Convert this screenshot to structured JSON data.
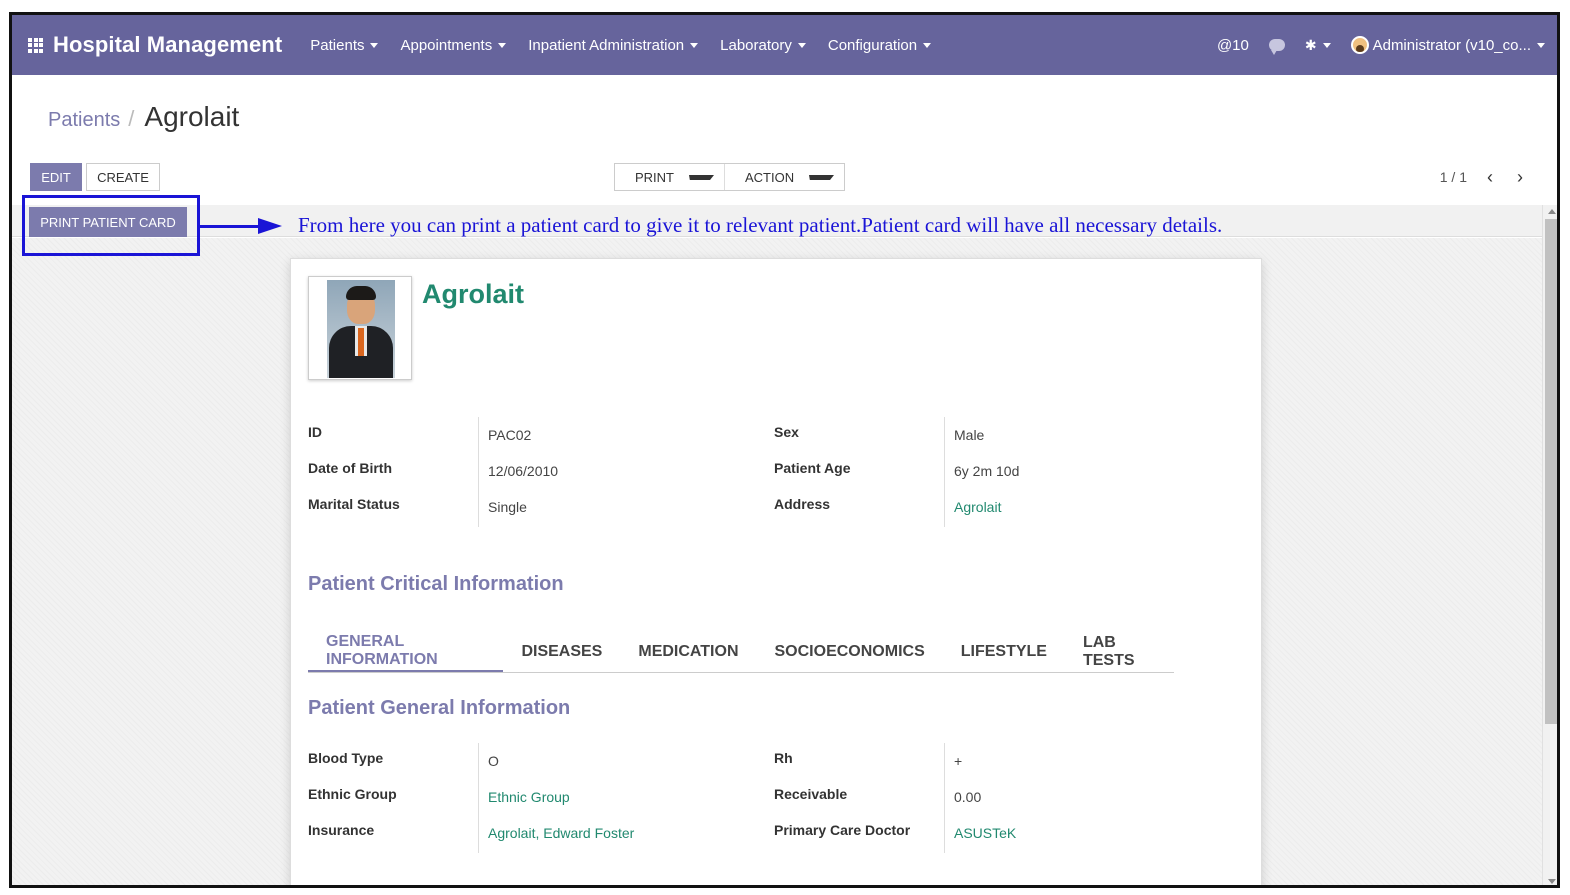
{
  "navbar": {
    "brand": "Hospital Management",
    "menu": [
      "Patients",
      "Appointments",
      "Inpatient Administration",
      "Laboratory",
      "Configuration"
    ],
    "mentions": "@10",
    "user": "Administrator (v10_co..."
  },
  "breadcrumb": {
    "parent": "Patients",
    "current": "Agrolait"
  },
  "toolbar": {
    "edit": "EDIT",
    "create": "CREATE",
    "print": "PRINT",
    "action": "ACTION"
  },
  "pager": {
    "value": "1 / 1",
    "prev": "‹",
    "next": "›"
  },
  "statusbar": {
    "print_card": "PRINT PATIENT CARD"
  },
  "annotation": "From here you can print a patient card to give it to relevant patient.Patient card will have all necessary details.",
  "patient": {
    "name": "Agrolait",
    "id_label": "ID",
    "id": "PAC02",
    "sex_label": "Sex",
    "sex": "Male",
    "dob_label": "Date of Birth",
    "dob": "12/06/2010",
    "age_label": "Patient Age",
    "age": "6y 2m 10d",
    "marital_label": "Marital Status",
    "marital": "Single",
    "address_label": "Address",
    "address": "Agrolait"
  },
  "critical_title": "Patient Critical Information",
  "tabs": [
    "GENERAL INFORMATION",
    "DISEASES",
    "MEDICATION",
    "SOCIOECONOMICS",
    "LIFESTYLE",
    "LAB TESTS"
  ],
  "general": {
    "title": "Patient General Information",
    "blood_label": "Blood Type",
    "blood": "O",
    "rh_label": "Rh",
    "rh": "+",
    "ethnic_label": "Ethnic Group",
    "ethnic": "Ethnic Group",
    "receivable_label": "Receivable",
    "receivable": "0.00",
    "insurance_label": "Insurance",
    "insurance": "Agrolait, Edward Foster",
    "doctor_label": "Primary Care Doctor",
    "doctor": "ASUSTeK"
  }
}
